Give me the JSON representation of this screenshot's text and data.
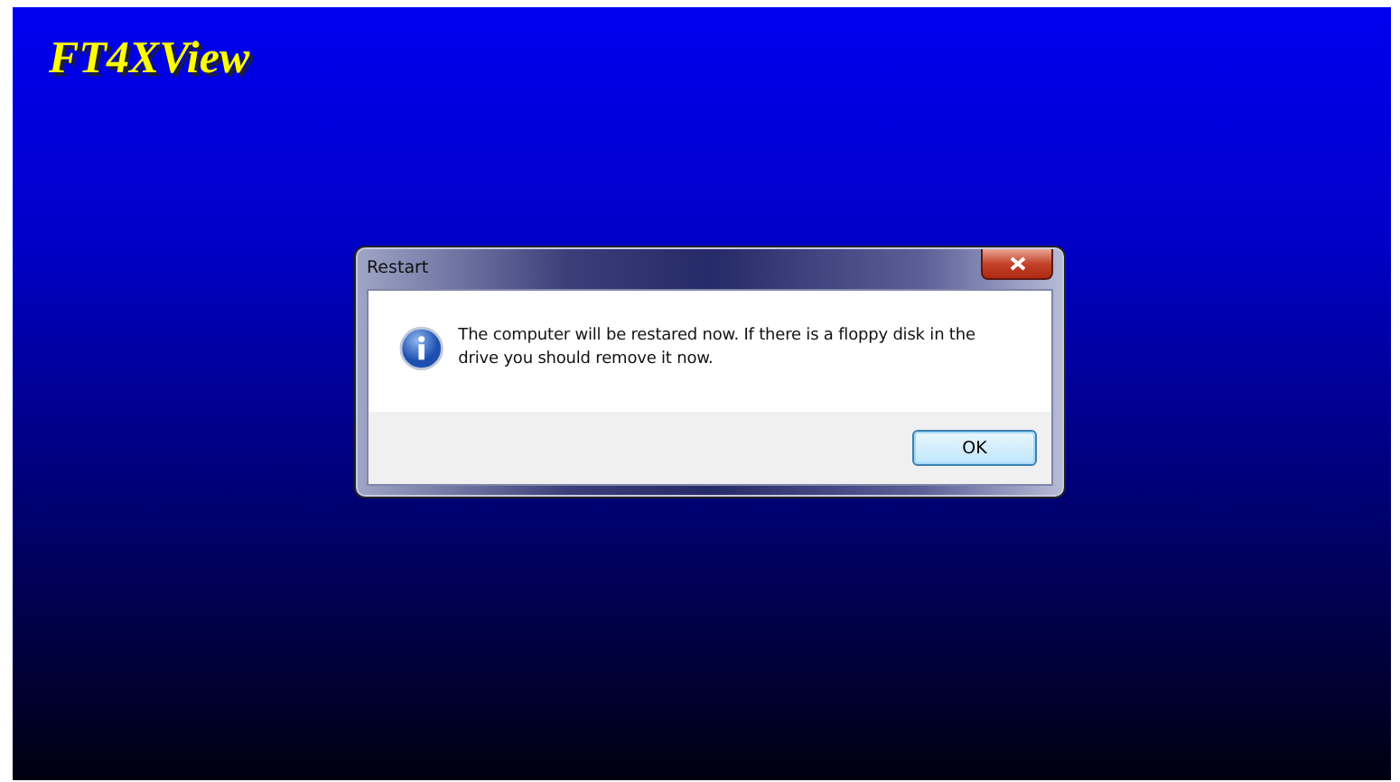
{
  "app": {
    "logo": "FT4XView"
  },
  "dialog": {
    "title": "Restart",
    "message": "The computer will be restared now. If there is a floppy disk in the drive you should remove it now.",
    "buttons": [
      {
        "label": "OK",
        "default": true
      }
    ]
  }
}
